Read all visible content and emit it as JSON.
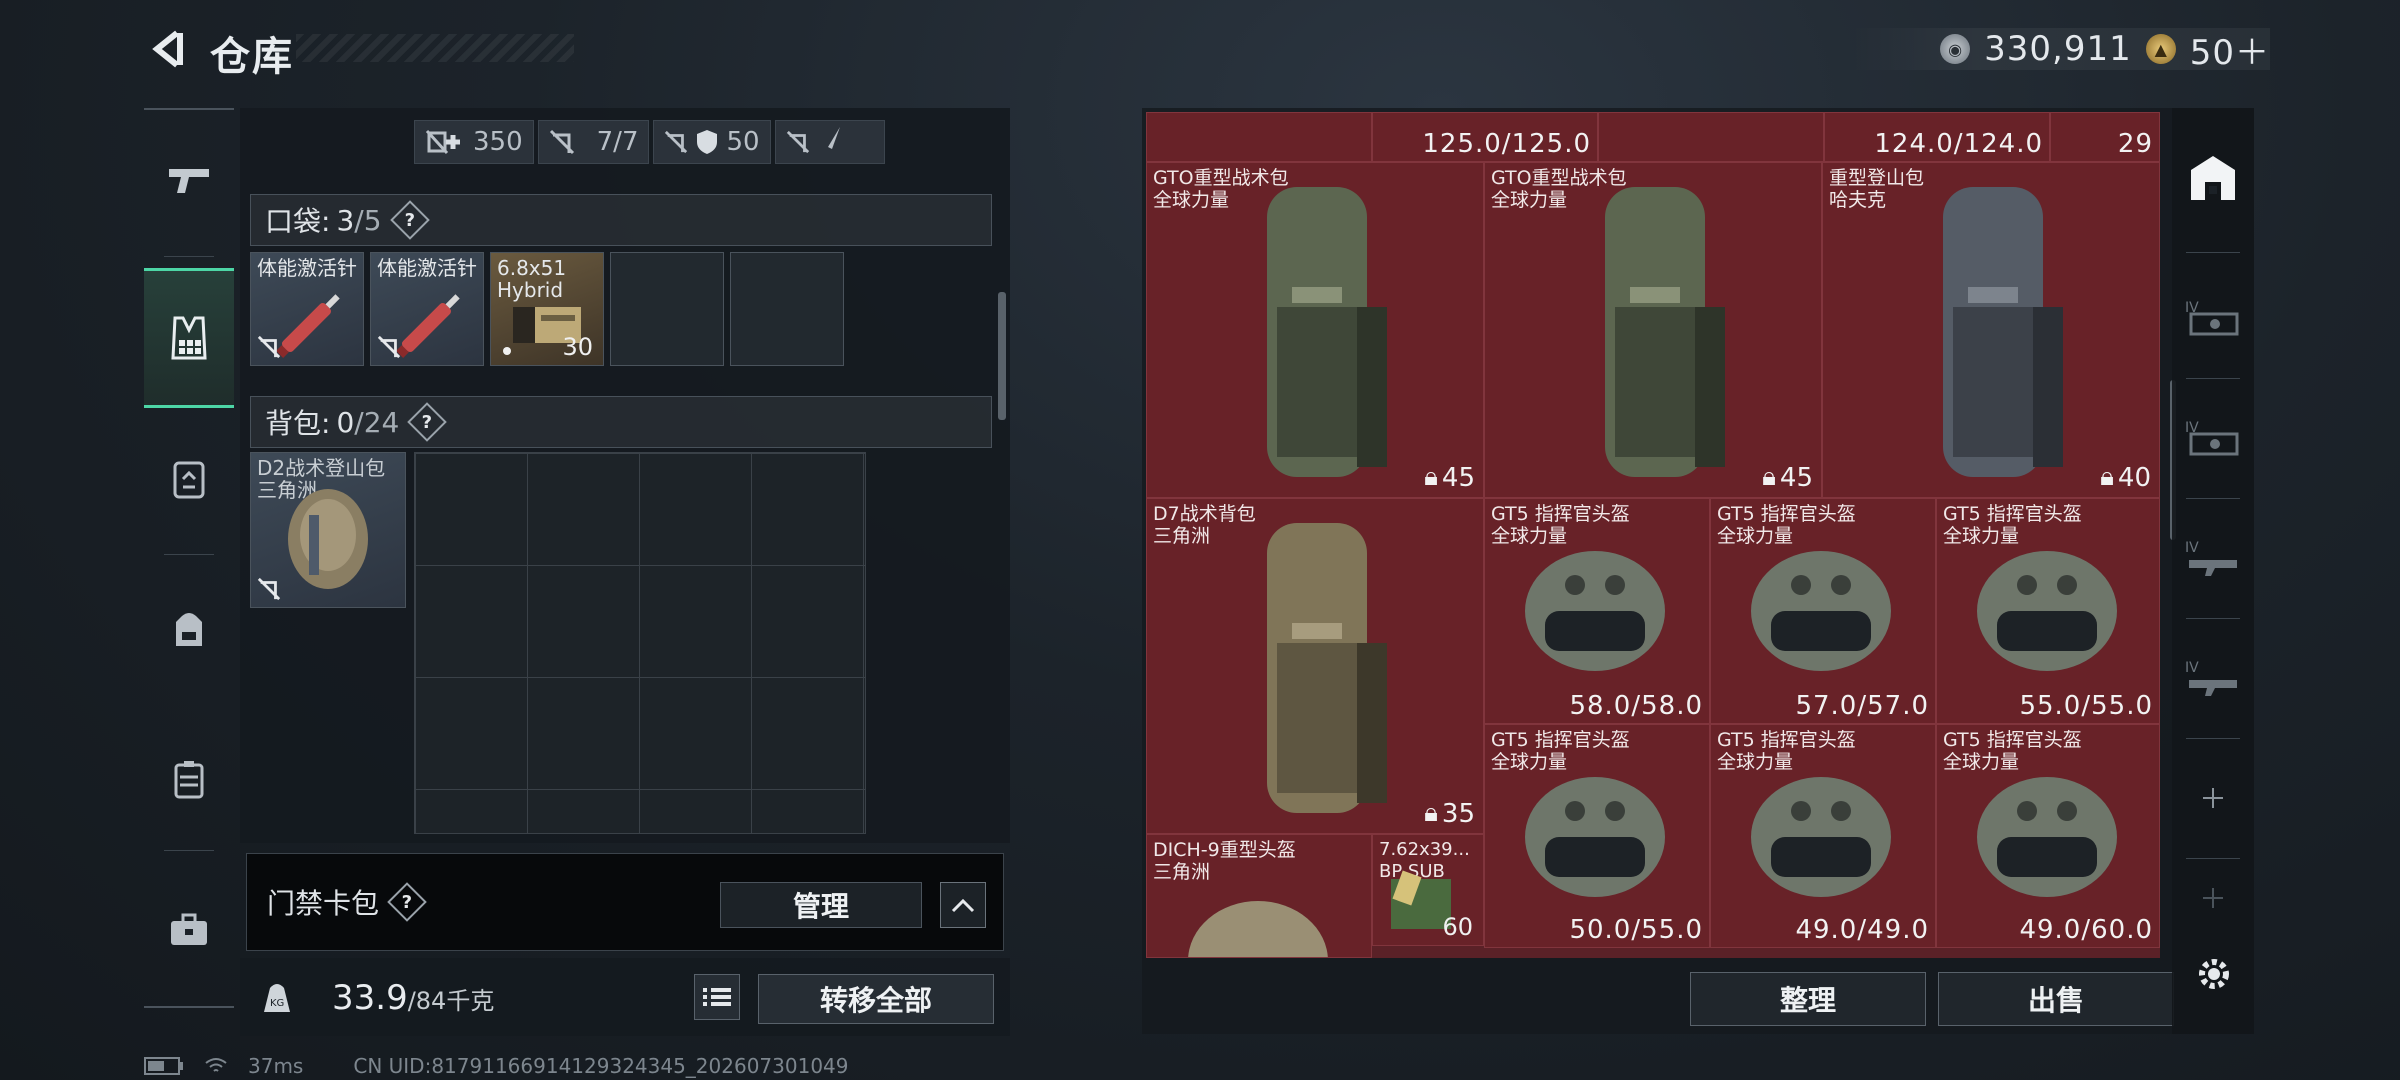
{
  "header": {
    "title": "仓库",
    "currencies": [
      {
        "icon": "silver-coin-icon",
        "value": "330,911"
      },
      {
        "icon": "gold-coin-icon",
        "value": "50＋"
      }
    ]
  },
  "left_nav": [
    "gun-icon",
    "vest-icon",
    "chest-rig-icon",
    "backpack-icon",
    "case-icon",
    "briefcase-icon"
  ],
  "stats": [
    {
      "icon": "medkit-icon",
      "value": "350"
    },
    {
      "icon": "durability-icon",
      "value": "7/7"
    },
    {
      "icon": "armor-icon",
      "value": "50"
    },
    {
      "icon": "knife-icon",
      "value": ""
    }
  ],
  "pocket": {
    "label": "口袋:",
    "used": "3",
    "capacity": "/5",
    "help": "?",
    "items": [
      {
        "name": "体能激活针",
        "type": "syringe"
      },
      {
        "name": "体能激活针",
        "type": "syringe"
      },
      {
        "name": "6.8x51\nHybrid",
        "type": "ammo",
        "count": "30"
      }
    ]
  },
  "backpack": {
    "label": "背包:",
    "used": "0",
    "capacity": "/24",
    "help": "?",
    "item": {
      "name": "D2战术登山包\n三角洲"
    }
  },
  "keycard": {
    "label": "门禁卡包",
    "help": "?",
    "manage": "管理"
  },
  "footer_left": {
    "weight": "33.9",
    "weight_max": "/84千克",
    "transfer_all": "转移全部"
  },
  "status": {
    "ping": "37ms",
    "uid": "CN UID:81791166914129324345_202607301049"
  },
  "warehouse": {
    "top_row": [
      "125.0/125.0",
      "124.0/124.0",
      "29"
    ],
    "items": [
      {
        "name": "GTO重型战术包\n全球力量",
        "cap": "45",
        "color": "#5c6650"
      },
      {
        "name": "GTO重型战术包\n全球力量",
        "cap": "45",
        "color": "#5c6650"
      },
      {
        "name": "重型登山包\n哈夫克",
        "cap": "40",
        "color": "#555c66"
      },
      {
        "name": "D7战术背包\n三角洲",
        "cap": "35",
        "color": "#807558"
      },
      {
        "name": "GT5 指挥官头盔\n全球力量",
        "dur": "58.0/58.0"
      },
      {
        "name": "GT5 指挥官头盔\n全球力量",
        "dur": "57.0/57.0"
      },
      {
        "name": "GT5 指挥官头盔\n全球力量",
        "dur": "55.0/55.0"
      },
      {
        "name": "GT5 指挥官头盔\n全球力量",
        "dur": "50.0/55.0"
      },
      {
        "name": "GT5 指挥官头盔\n全球力量",
        "dur": "49.0/49.0"
      },
      {
        "name": "GT5 指挥官头盔\n全球力量",
        "dur": "49.0/60.0"
      },
      {
        "name": "DICH-9重型头盔\n三角洲"
      },
      {
        "name": "7.62x39...\nBP SUB",
        "count": "60"
      }
    ],
    "sort_label": "整理",
    "sell_label": "出售"
  },
  "right_rail": [
    "safehouse-icon",
    "tier4-gun-icon",
    "tier4-gun-icon",
    "tier4-rifle-icon",
    "tier4-rifle-icon",
    "add-icon",
    "add-icon"
  ]
}
